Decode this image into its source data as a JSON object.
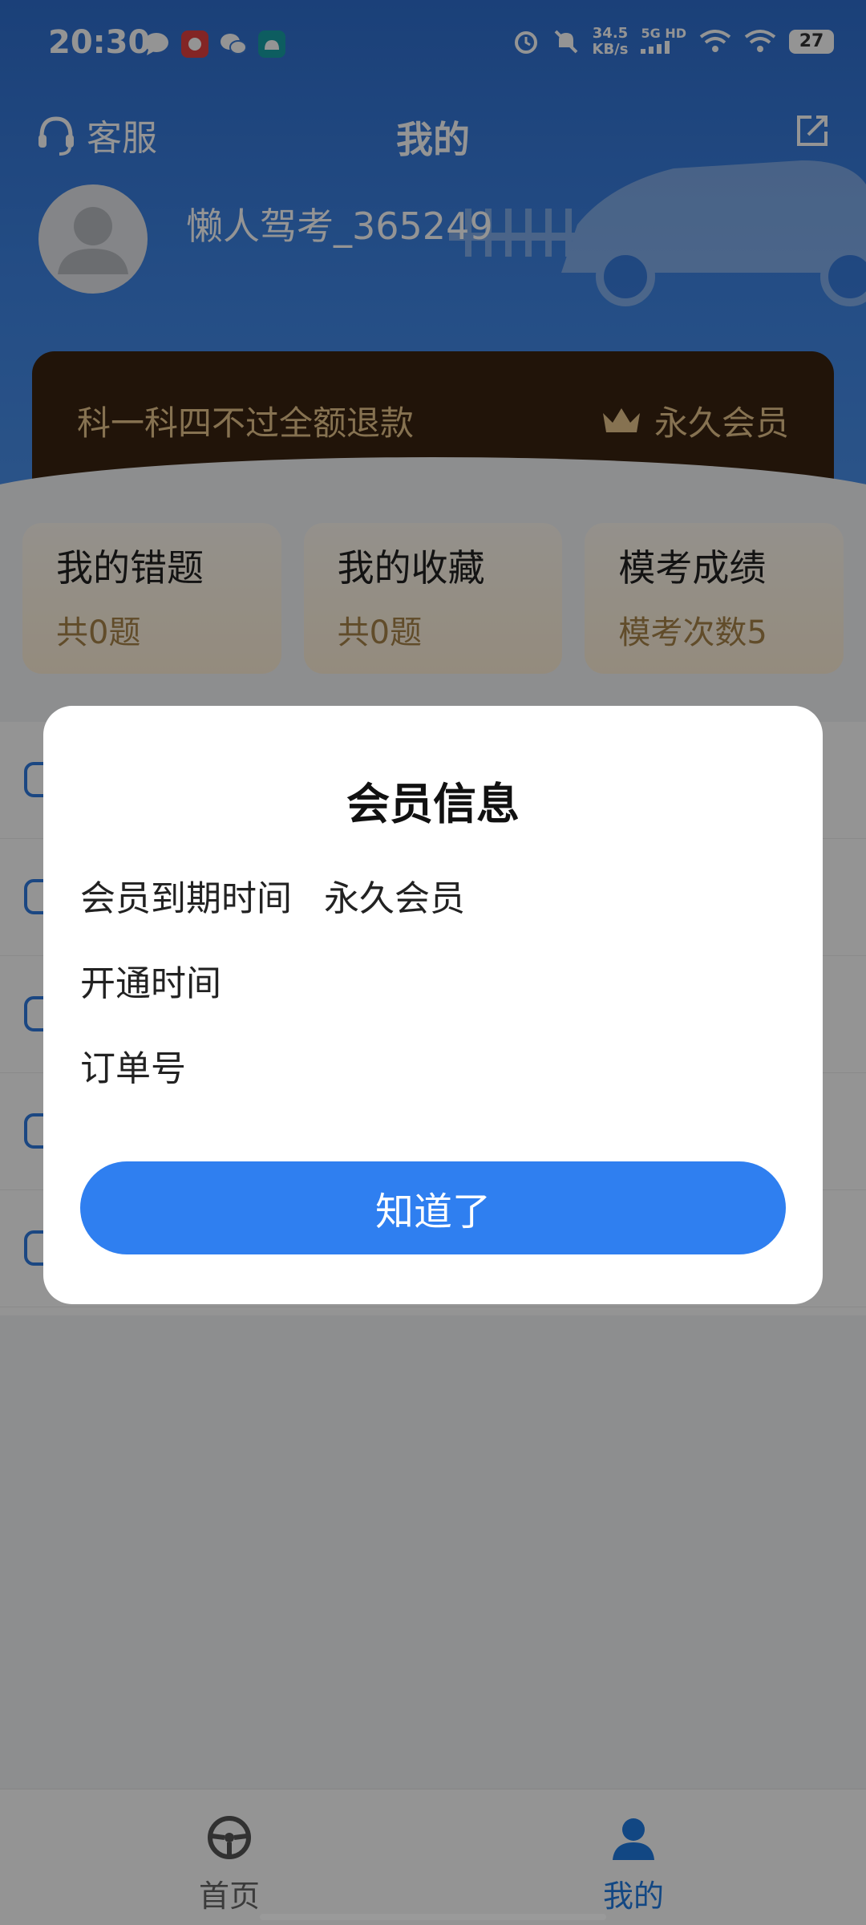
{
  "status_bar": {
    "time": "20:30",
    "net_speed": "34.5",
    "net_speed_unit": "KB/s",
    "network": "5G HD",
    "battery": "27",
    "icons": [
      "message-icon",
      "app-icon",
      "wechat-icon",
      "android-icon",
      "alarm-icon",
      "mute-icon",
      "signal-icon",
      "wifi-icon",
      "battery-icon"
    ]
  },
  "header": {
    "customer_service_label": "客服",
    "title": "我的",
    "username": "懒人驾考_365249"
  },
  "vip_banner": {
    "slogan": "科一科四不过全额退款",
    "level": "永久会员"
  },
  "stats": [
    {
      "title": "我的错题",
      "value": "共0题"
    },
    {
      "title": "我的收藏",
      "value": "共0题"
    },
    {
      "title": "模考成绩",
      "value": "模考次数5"
    }
  ],
  "dialog": {
    "title": "会员信息",
    "rows": [
      {
        "label": "会员到期时间",
        "value": "永久会员"
      },
      {
        "label": "开通时间",
        "value": ""
      },
      {
        "label": "订单号",
        "value": ""
      }
    ],
    "button_label": "知道了"
  },
  "bottom_nav": {
    "tabs": [
      {
        "label": "首页",
        "icon": "steering-wheel-icon"
      },
      {
        "label": "我的",
        "icon": "user-icon"
      }
    ],
    "active": "我的"
  },
  "colors": {
    "primary": "#2f7ff0",
    "header_blue": "#3f86e6",
    "vip_bg": "#3a2410",
    "vip_text": "#e7c58c",
    "stat_value": "#a78349"
  }
}
